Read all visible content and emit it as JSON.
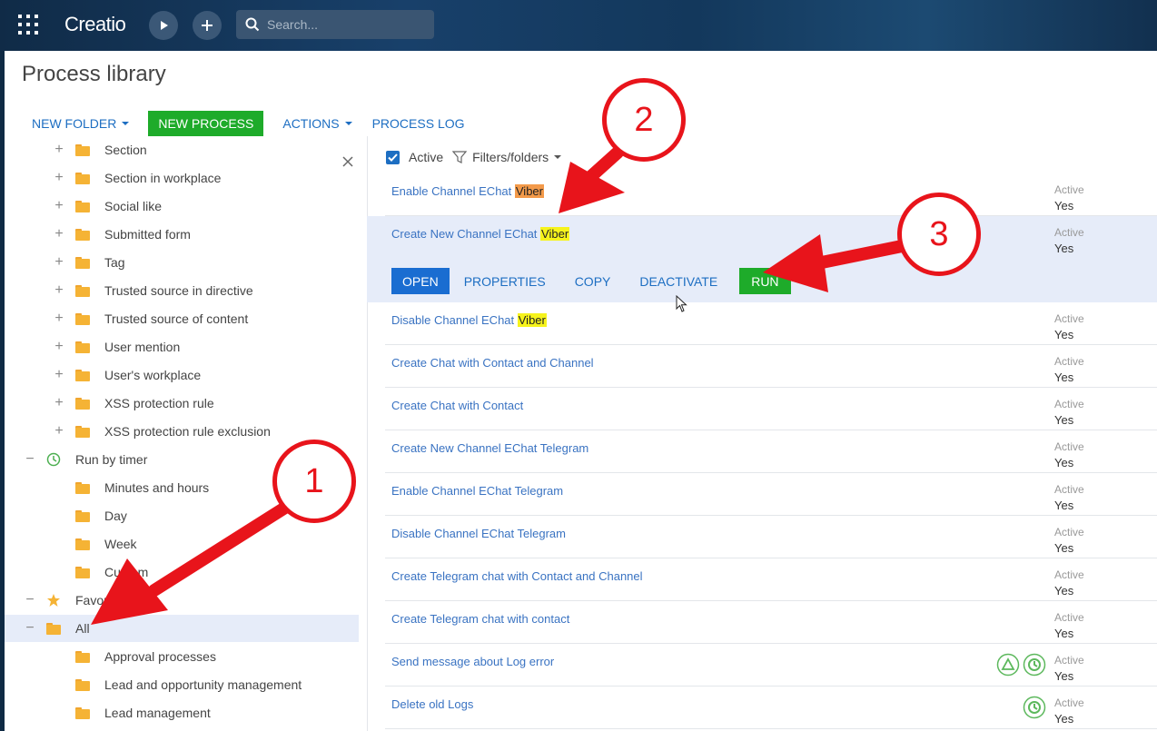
{
  "header": {
    "logo_text": "Creatio",
    "search_placeholder": "Search..."
  },
  "page": {
    "title": "Process library"
  },
  "toolbar": {
    "new_folder": "NEW FOLDER",
    "new_process": "NEW PROCESS",
    "actions": "ACTIONS",
    "process_log": "PROCESS LOG"
  },
  "tree": {
    "items": [
      {
        "label": "Section",
        "level": 2,
        "expander": "+",
        "icon": "folder-icon"
      },
      {
        "label": "Section in workplace",
        "level": 2,
        "expander": "+",
        "icon": "folder-icon"
      },
      {
        "label": "Social like",
        "level": 2,
        "expander": "+",
        "icon": "folder-icon"
      },
      {
        "label": "Submitted form",
        "level": 2,
        "expander": "+",
        "icon": "folder-icon"
      },
      {
        "label": "Tag",
        "level": 2,
        "expander": "+",
        "icon": "folder-icon"
      },
      {
        "label": "Trusted source in directive",
        "level": 2,
        "expander": "+",
        "icon": "folder-icon"
      },
      {
        "label": "Trusted source of content",
        "level": 2,
        "expander": "+",
        "icon": "folder-icon"
      },
      {
        "label": "User mention",
        "level": 2,
        "expander": "+",
        "icon": "folder-icon"
      },
      {
        "label": "User's workplace",
        "level": 2,
        "expander": "+",
        "icon": "folder-icon"
      },
      {
        "label": "XSS protection rule",
        "level": 2,
        "expander": "+",
        "icon": "folder-icon"
      },
      {
        "label": "XSS protection rule exclusion",
        "level": 2,
        "expander": "+",
        "icon": "folder-icon"
      },
      {
        "label": "Run by timer",
        "level": 1,
        "expander": "−",
        "icon": "timer-icon"
      },
      {
        "label": "Minutes and hours",
        "level": 2,
        "expander": "",
        "icon": "folder-icon"
      },
      {
        "label": "Day",
        "level": 2,
        "expander": "",
        "icon": "folder-icon"
      },
      {
        "label": "Week",
        "level": 2,
        "expander": "",
        "icon": "folder-icon"
      },
      {
        "label": "Custom",
        "level": 2,
        "expander": "",
        "icon": "folder-icon"
      },
      {
        "label": "Favorites",
        "level": 1,
        "expander": "−",
        "icon": "star-icon"
      },
      {
        "label": "All",
        "level": 1,
        "expander": "−",
        "icon": "folder-icon",
        "selected": true
      },
      {
        "label": "Approval processes",
        "level": 2,
        "expander": "",
        "icon": "folder-icon"
      },
      {
        "label": "Lead and opportunity management",
        "level": 2,
        "expander": "",
        "icon": "folder-icon"
      },
      {
        "label": "Lead management",
        "level": 2,
        "expander": "",
        "icon": "folder-icon"
      }
    ]
  },
  "filters": {
    "active_label": "Active",
    "filters_folders": "Filters/folders"
  },
  "list": {
    "status_label": "Active",
    "rows": [
      {
        "prefix": "Enable Channel EChat ",
        "highlight": "Viber",
        "highlight_color": "#f39a4a",
        "value": "Yes"
      },
      {
        "prefix": "Create New Channel EChat ",
        "highlight": "Viber",
        "highlight_color": "#f6f31c",
        "value": "Yes",
        "active": true
      },
      {
        "prefix": "Disable Channel EChat ",
        "highlight": "Viber",
        "highlight_color": "#f6f31c",
        "value": "Yes"
      },
      {
        "prefix": "Create Chat with Contact and Channel",
        "highlight": "",
        "value": "Yes"
      },
      {
        "prefix": "Create Chat with Contact",
        "highlight": "",
        "value": "Yes"
      },
      {
        "prefix": "Create New Channel EChat Telegram",
        "highlight": "",
        "value": "Yes"
      },
      {
        "prefix": "Enable Channel EChat Telegram",
        "highlight": "",
        "value": "Yes"
      },
      {
        "prefix": "Disable Channel EChat Telegram",
        "highlight": "",
        "value": "Yes"
      },
      {
        "prefix": "Create Telegram chat with Contact and Channel",
        "highlight": "",
        "value": "Yes"
      },
      {
        "prefix": "Create Telegram chat with contact",
        "highlight": "",
        "value": "Yes"
      },
      {
        "prefix": "Send message about Log error",
        "highlight": "",
        "value": "Yes",
        "icons": [
          "signal-icon",
          "timer-icon"
        ]
      },
      {
        "prefix": "Delete old Logs",
        "highlight": "",
        "value": "Yes",
        "icons": [
          "timer-icon"
        ]
      }
    ]
  },
  "row_actions": {
    "open": "OPEN",
    "properties": "PROPERTIES",
    "copy": "COPY",
    "deactivate": "DEACTIVATE",
    "run": "RUN"
  },
  "annotations": {
    "badges": [
      "1",
      "2",
      "3"
    ],
    "color": "#e8141b"
  }
}
